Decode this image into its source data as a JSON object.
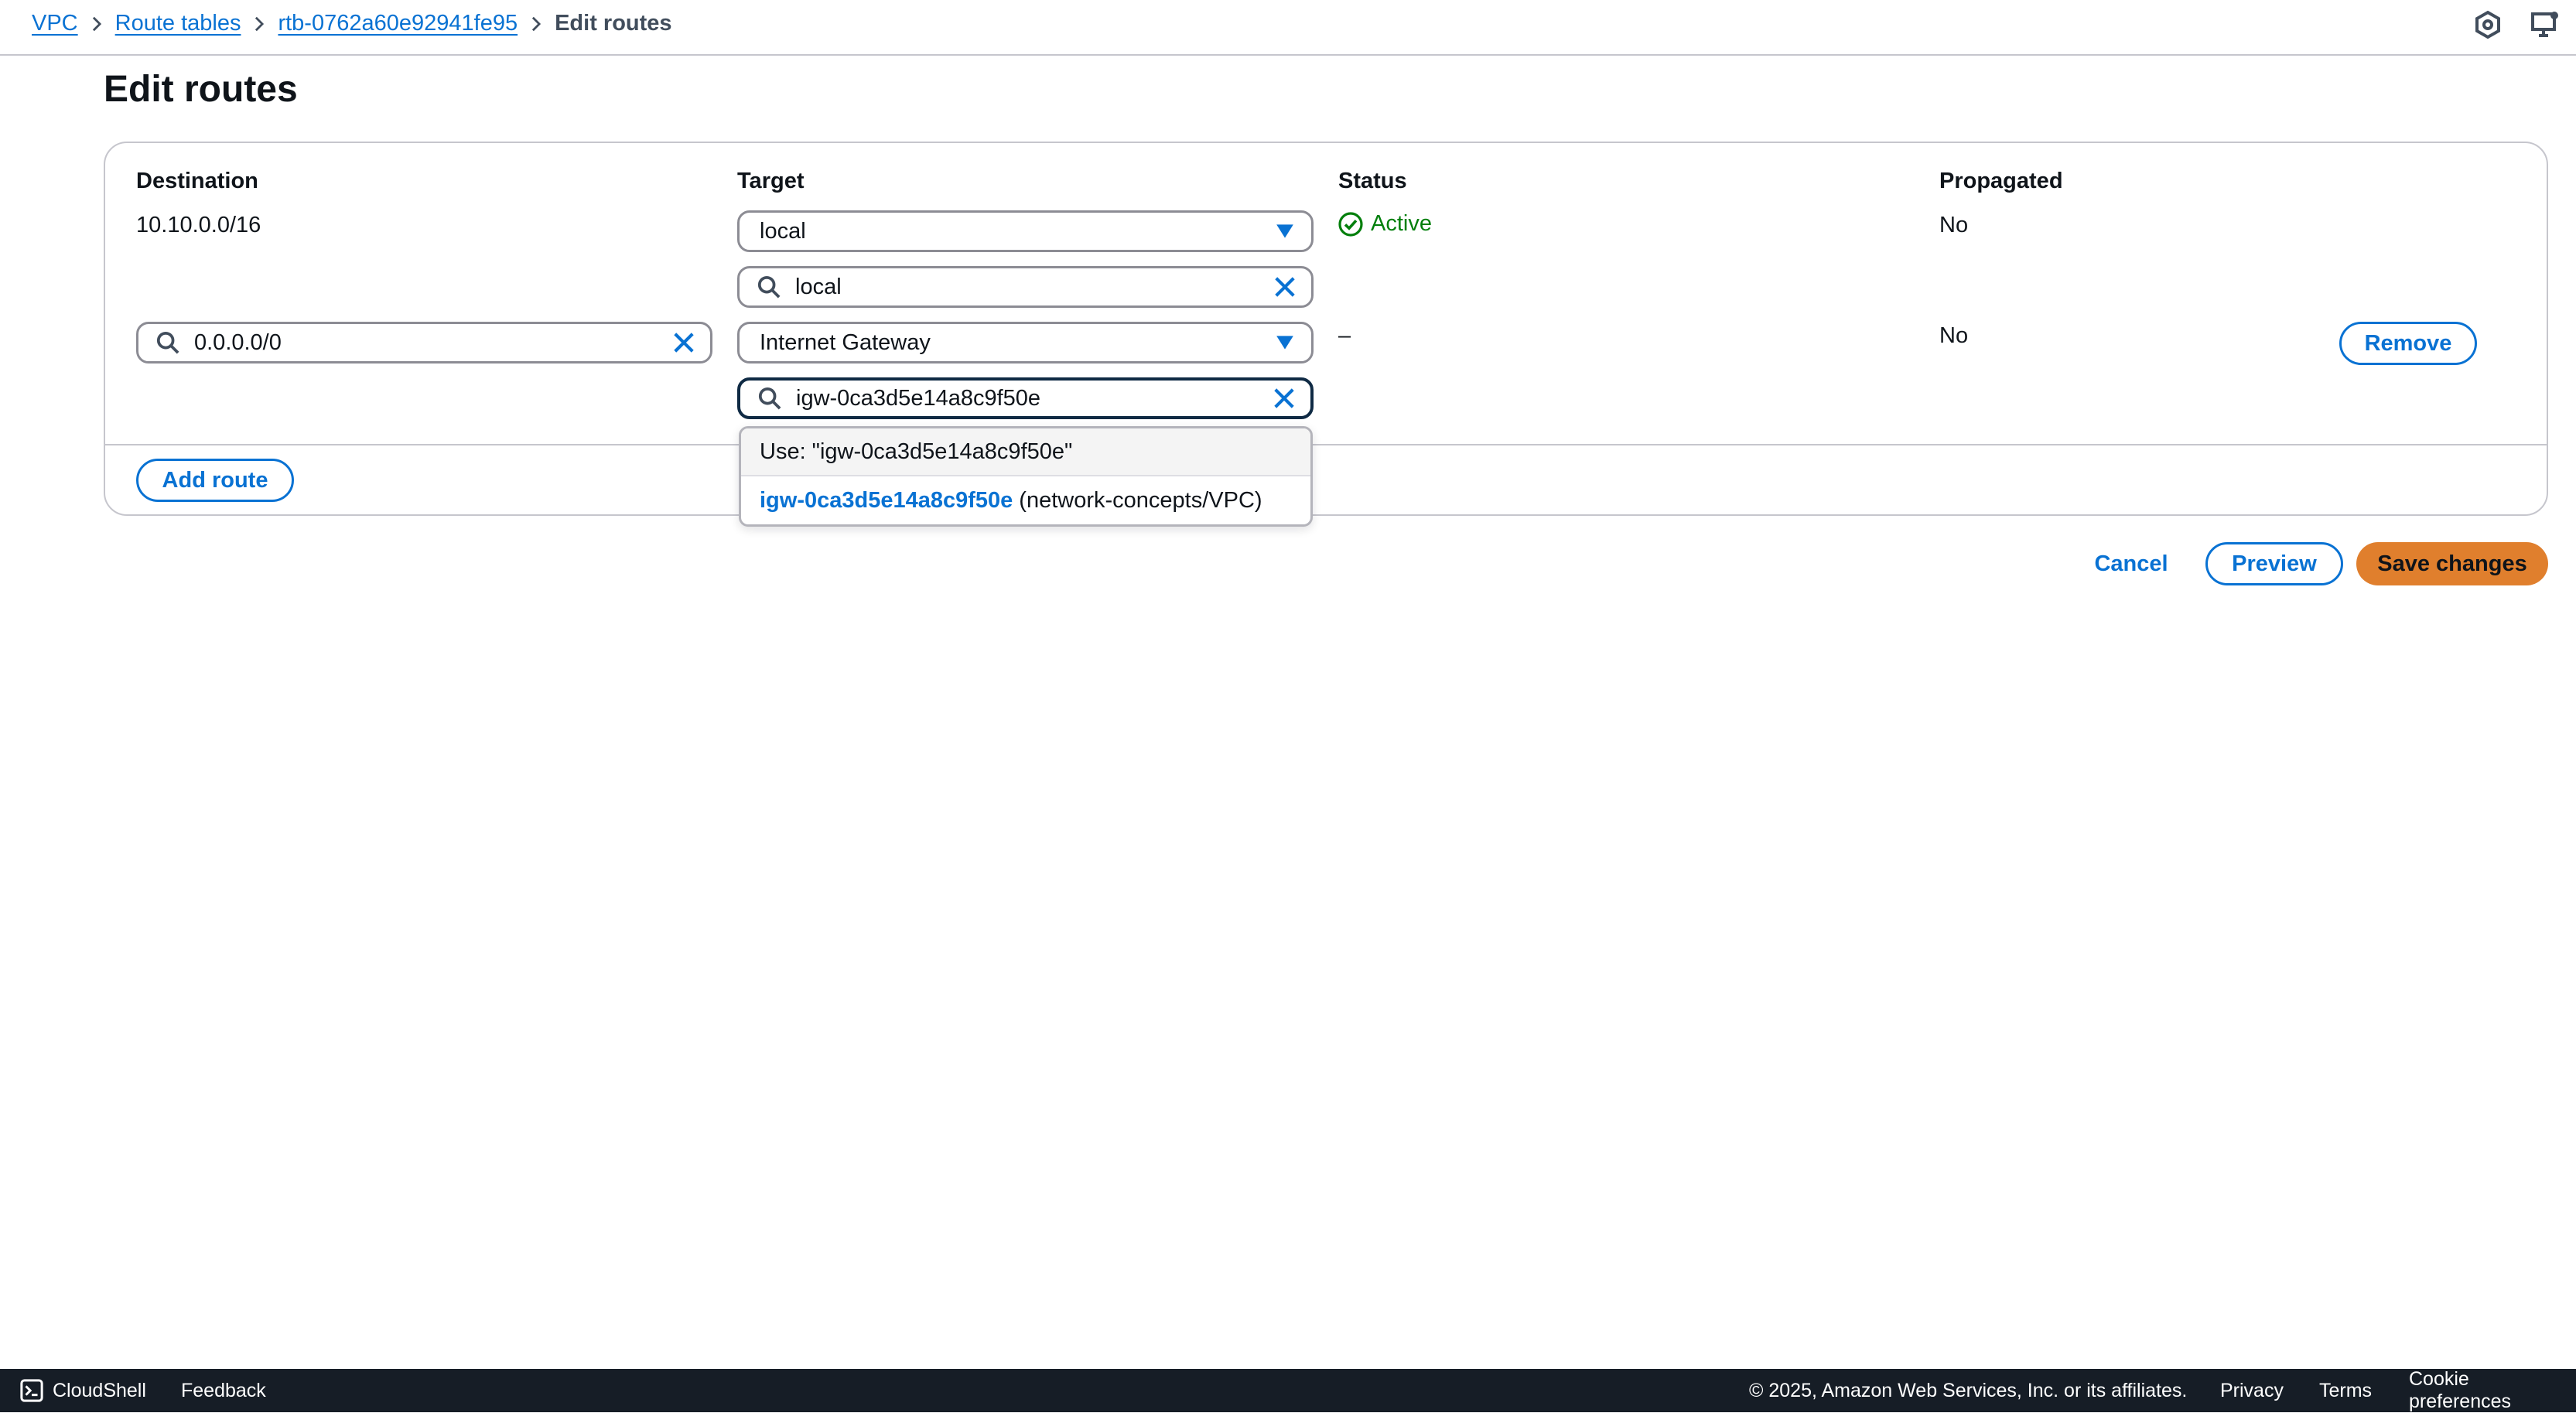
{
  "breadcrumb": {
    "items": [
      "VPC",
      "Route tables",
      "rtb-0762a60e92941fe95"
    ],
    "current": "Edit routes"
  },
  "page": {
    "title": "Edit routes"
  },
  "columns": {
    "destination": "Destination",
    "target": "Target",
    "status": "Status",
    "propagated": "Propagated"
  },
  "routes": [
    {
      "destination": "10.10.0.0/16",
      "target_type": "local",
      "target_search": "local",
      "status": "Active",
      "propagated": "No"
    },
    {
      "destination": "0.0.0.0/0",
      "target_type": "Internet Gateway",
      "target_search": "igw-0ca3d5e14a8c9f50e",
      "status": "–",
      "propagated": "No",
      "remove_label": "Remove"
    }
  ],
  "dropdown": {
    "use_option": "Use: \"igw-0ca3d5e14a8c9f50e\"",
    "match_id": "igw-0ca3d5e14a8c9f50e",
    "match_desc": "(network-concepts/VPC)"
  },
  "actions": {
    "add_route": "Add route",
    "cancel": "Cancel",
    "preview": "Preview",
    "save": "Save changes"
  },
  "footer": {
    "cloudshell": "CloudShell",
    "feedback": "Feedback",
    "copyright": "© 2025, Amazon Web Services, Inc. or its affiliates.",
    "privacy": "Privacy",
    "terms": "Terms",
    "cookies": "Cookie preferences"
  },
  "colors": {
    "link": "#0972d3",
    "success": "#037f0c",
    "primary_button": "#e07f2d",
    "footer_bg": "#161d26",
    "border": "#8c8c94"
  },
  "icons": [
    "chevron-right-icon",
    "settings-hexagon-icon",
    "screen-notifications-icon",
    "search-icon",
    "clear-x-icon",
    "caret-down-icon",
    "status-success-icon",
    "cloudshell-icon"
  ]
}
